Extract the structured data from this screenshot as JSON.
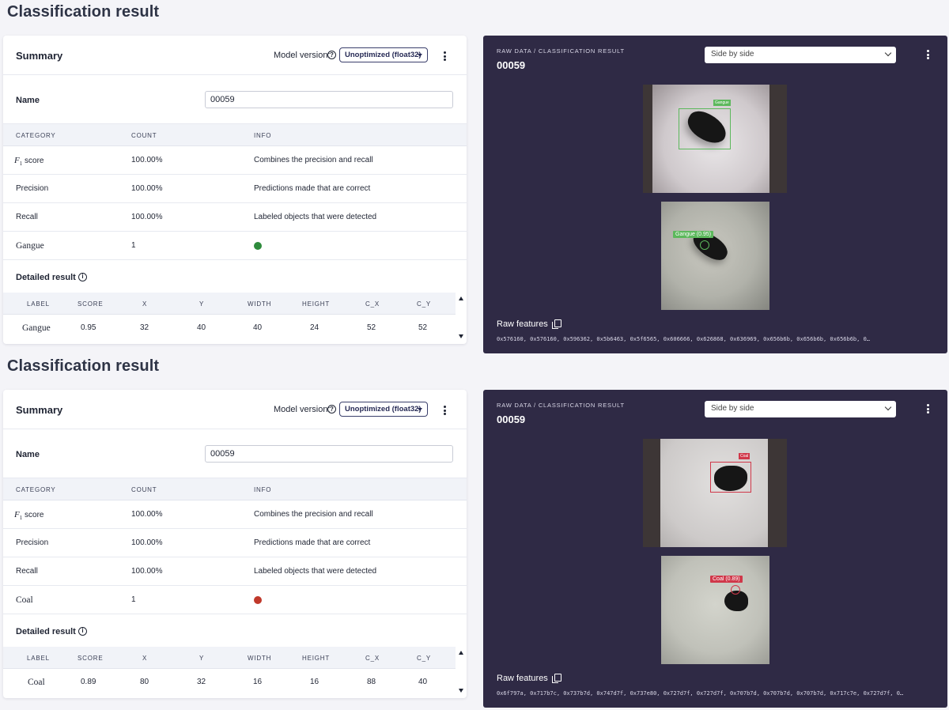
{
  "results": [
    {
      "title": "Classification result",
      "summary": {
        "title": "Summary",
        "model_label": "Model version:",
        "model_value": "Unoptimized (float32)",
        "name_label": "Name",
        "name_value": "00059",
        "headers": [
          "CATEGORY",
          "COUNT",
          "INFO"
        ],
        "rows": [
          {
            "category": "score",
            "count": "100.00%",
            "info": "Combines the precision and recall"
          },
          {
            "category": "Precision",
            "count": "100.00%",
            "info": "Predictions made that are correct"
          },
          {
            "category": "Recall",
            "count": "100.00%",
            "info": "Labeled objects that were detected"
          },
          {
            "category": "Gangue",
            "count": "1",
            "info_color": "#2e8b3c"
          }
        ],
        "detailed_title": "Detailed result",
        "detail_headers": [
          "LABEL",
          "SCORE",
          "X",
          "Y",
          "WIDTH",
          "HEIGHT",
          "C_X",
          "C_Y"
        ],
        "detail_row": [
          "Gangue",
          "0.95",
          "32",
          "40",
          "40",
          "24",
          "52",
          "52"
        ]
      },
      "raw": {
        "label": "RAW DATA / CLASSIFICATION RESULT",
        "id": "00059",
        "view": "Side by side",
        "box_label": "Gangue",
        "pred_label": "Gangue (0.95)",
        "accent": "#5cb85c",
        "features_label": "Raw features",
        "features": "0x576160, 0x576160, 0x596362, 0x5b6463, 0x5f6565, 0x606666, 0x626868, 0x636969, 0x656b6b, 0x656b6b, 0x656b6b, 0…"
      }
    },
    {
      "title": "Classification result",
      "summary": {
        "title": "Summary",
        "model_label": "Model version:",
        "model_value": "Unoptimized (float32)",
        "name_label": "Name",
        "name_value": "00059",
        "headers": [
          "CATEGORY",
          "COUNT",
          "INFO"
        ],
        "rows": [
          {
            "category": "score",
            "count": "100.00%",
            "info": "Combines the precision and recall"
          },
          {
            "category": "Precision",
            "count": "100.00%",
            "info": "Predictions made that are correct"
          },
          {
            "category": "Recall",
            "count": "100.00%",
            "info": "Labeled objects that were detected"
          },
          {
            "category": "Coal",
            "count": "1",
            "info_color": "#c0392b"
          }
        ],
        "detailed_title": "Detailed result",
        "detail_headers": [
          "LABEL",
          "SCORE",
          "X",
          "Y",
          "WIDTH",
          "HEIGHT",
          "C_X",
          "C_Y"
        ],
        "detail_row": [
          "Coal",
          "0.89",
          "80",
          "32",
          "16",
          "16",
          "88",
          "40"
        ]
      },
      "raw": {
        "label": "RAW DATA / CLASSIFICATION RESULT",
        "id": "00059",
        "view": "Side by side",
        "box_label": "Coal",
        "pred_label": "Coal (0.89)",
        "accent": "#d0384a",
        "features_label": "Raw features",
        "features": "0x6f797a, 0x717b7c, 0x737b7d, 0x747d7f, 0x737e80, 0x727d7f, 0x727d7f, 0x707b7d, 0x707b7d, 0x707b7d, 0x717c7e, 0x727d7f, 0…"
      }
    }
  ]
}
